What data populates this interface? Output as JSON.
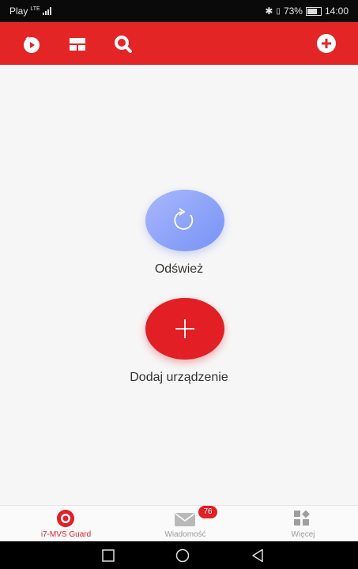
{
  "status_bar": {
    "carrier": "Play",
    "network": "LTE",
    "battery_percent": "73%",
    "time": "14:00"
  },
  "toolbar": {
    "icons": [
      "playback-icon",
      "layout-icon",
      "search-icon",
      "add-icon"
    ],
    "background_color": "#e32526"
  },
  "main": {
    "refresh_label": "Odśwież",
    "add_device_label": "Dodaj urządzenie"
  },
  "bottom_nav": {
    "items": [
      {
        "label": "i7-MVS Guard",
        "icon": "camera-icon",
        "active": true
      },
      {
        "label": "Wiadomość",
        "icon": "mail-icon",
        "badge": "76",
        "active": false
      },
      {
        "label": "Więcej",
        "icon": "grid-icon",
        "active": false
      }
    ],
    "active_color": "#e21f24",
    "inactive_color": "#999999"
  },
  "colors": {
    "accent": "#e21f24",
    "refresh_gradient_start": "#aab7fb",
    "refresh_gradient_end": "#7693f6"
  }
}
